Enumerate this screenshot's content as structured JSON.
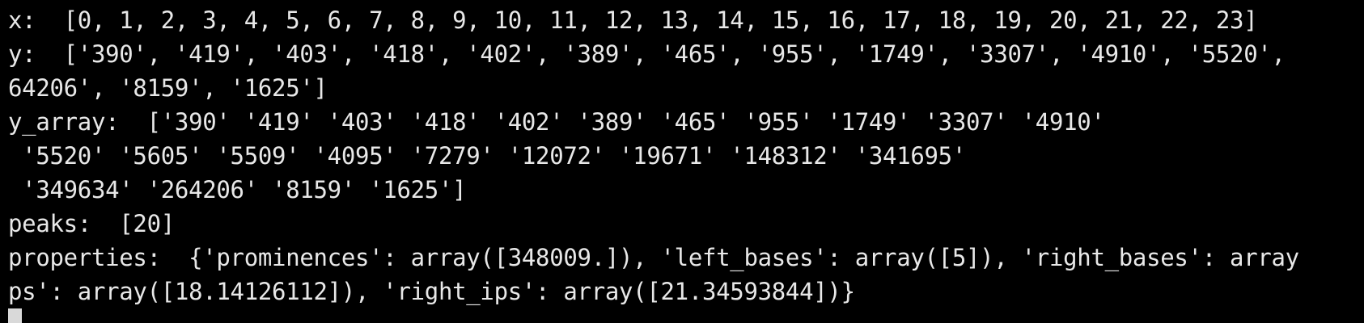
{
  "terminal": {
    "lines": [
      "x:  [0, 1, 2, 3, 4, 5, 6, 7, 8, 9, 10, 11, 12, 13, 14, 15, 16, 17, 18, 19, 20, 21, 22, 23]",
      "y:  ['390', '419', '403', '418', '402', '389', '465', '955', '1749', '3307', '4910', '5520',",
      "64206', '8159', '1625']",
      "y_array:  ['390' '419' '403' '418' '402' '389' '465' '955' '1749' '3307' '4910'",
      " '5520' '5605' '5509' '4095' '7279' '12072' '19671' '148312' '341695'",
      " '349634' '264206' '8159' '1625']",
      "peaks:  [20]",
      "properties:  {'prominences': array([348009.]), 'left_bases': array([5]), 'right_bases': array",
      "ps': array([18.14126112]), 'right_ips': array([21.34593844])}"
    ]
  }
}
